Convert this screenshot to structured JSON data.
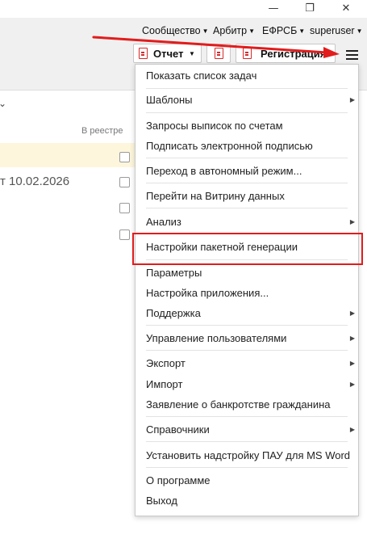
{
  "window": {
    "minimize_icon": "minimize-icon",
    "maximize_icon": "restore-icon",
    "close_icon": "close-icon",
    "minimize_glyph": "—",
    "maximize_glyph": "❐",
    "close_glyph": "✕"
  },
  "topnav": {
    "community": "Сообщество",
    "arbitr": "Арбитр",
    "efrsb": "ЕФРСБ",
    "user": "superuser"
  },
  "toolbar": {
    "report_label": "Отчет",
    "registration_label": "Регистрация",
    "menu_icon": "hamburger-menu-icon"
  },
  "background": {
    "column_header": "В реестре",
    "date_text": "т 10.02.2026",
    "highlight_color": "#fdf6dc"
  },
  "menu": {
    "items": [
      {
        "label": "Показать список задач",
        "submenu": false
      },
      {
        "label": "Шаблоны",
        "submenu": true
      },
      {
        "label": "Запросы выписок по счетам",
        "submenu": false
      },
      {
        "label": "Подписать электронной подписью",
        "submenu": false
      },
      {
        "label": "Переход в автономный режим...",
        "submenu": false
      },
      {
        "label": "Перейти на Витрину данных",
        "submenu": false
      },
      {
        "label": "Анализ",
        "submenu": true
      },
      {
        "label": "Настройки пакетной генерации",
        "submenu": false,
        "highlighted": true
      },
      {
        "label": "Параметры",
        "submenu": false
      },
      {
        "label": "Настройка приложения...",
        "submenu": false
      },
      {
        "label": "Поддержка",
        "submenu": true
      },
      {
        "label": "Управление пользователями",
        "submenu": true
      },
      {
        "label": "Экспорт",
        "submenu": true
      },
      {
        "label": "Импорт",
        "submenu": true
      },
      {
        "label": "Заявление о банкротстве гражданина",
        "submenu": false
      },
      {
        "label": "Справочники",
        "submenu": true
      },
      {
        "label": "Установить надстройку ПАУ для MS Word",
        "submenu": false
      },
      {
        "label": "О программе",
        "submenu": false
      },
      {
        "label": "Выход",
        "submenu": false
      }
    ]
  },
  "annotation": {
    "color": "#e21c1c"
  }
}
